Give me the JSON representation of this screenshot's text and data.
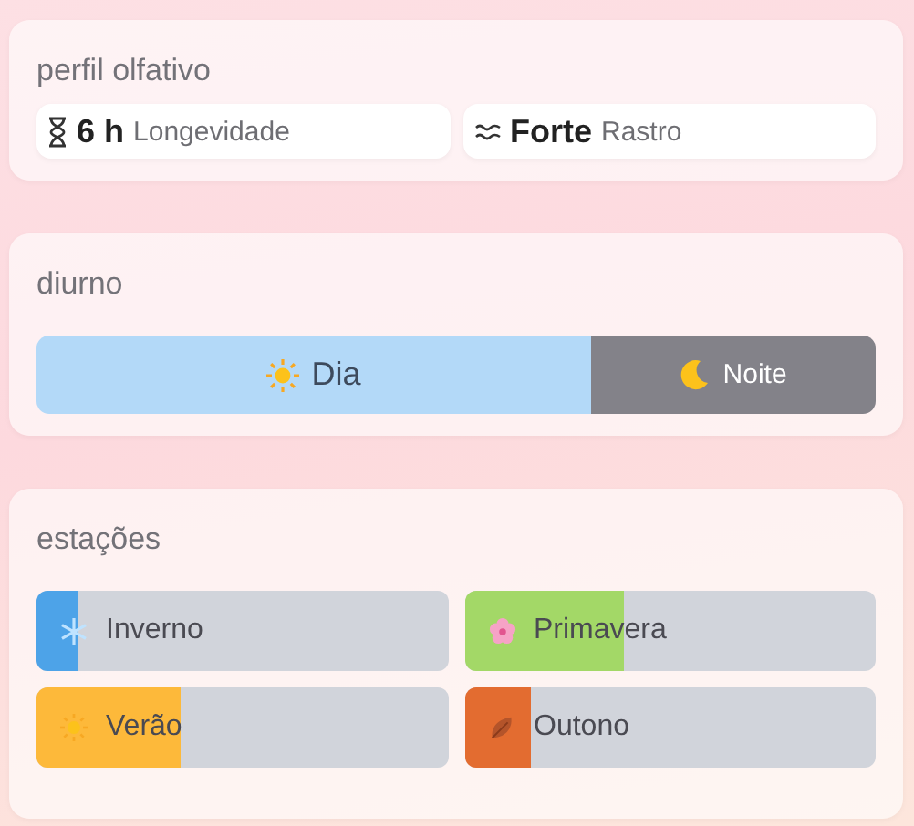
{
  "profile": {
    "title": "perfil olfativo",
    "stats": [
      {
        "kind": "duration",
        "value": "6 h",
        "label": "Longevidade"
      },
      {
        "kind": "sillage",
        "value": "Forte",
        "label": "Rastro"
      }
    ]
  },
  "daytime": {
    "title": "diurno",
    "segments": [
      {
        "kind": "day",
        "label": "Dia",
        "level": 0.66
      },
      {
        "kind": "night",
        "label": "Noite",
        "level": 0.34
      }
    ]
  },
  "seasons": {
    "title": "estações",
    "items": [
      {
        "kind": "winter",
        "label": "Inverno",
        "level": 0.1,
        "color": "#4da3e8"
      },
      {
        "kind": "spring",
        "label": "Primavera",
        "level": 0.39,
        "color": "#a3d867"
      },
      {
        "kind": "summer",
        "label": "Verão",
        "level": 0.35,
        "color": "#fdb93a"
      },
      {
        "kind": "autumn",
        "label": "Outono",
        "level": 0.16,
        "color": "#e36c30"
      }
    ]
  }
}
